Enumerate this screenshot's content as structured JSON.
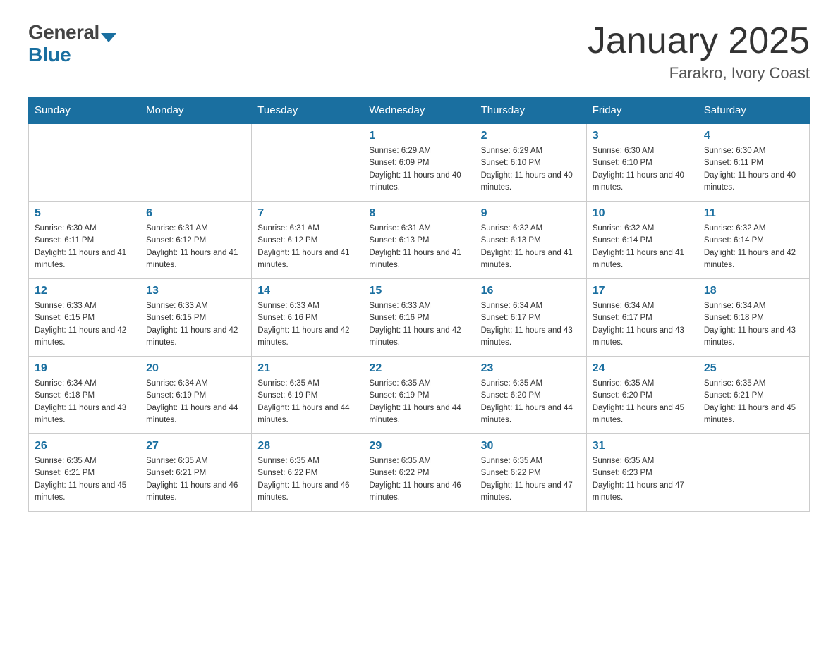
{
  "header": {
    "logo_general": "General",
    "logo_icon": "▼",
    "logo_blue": "Blue",
    "month_title": "January 2025",
    "location": "Farakro, Ivory Coast"
  },
  "days_of_week": [
    "Sunday",
    "Monday",
    "Tuesday",
    "Wednesday",
    "Thursday",
    "Friday",
    "Saturday"
  ],
  "weeks": [
    [
      {
        "day": "",
        "sunrise": "",
        "sunset": "",
        "daylight": ""
      },
      {
        "day": "",
        "sunrise": "",
        "sunset": "",
        "daylight": ""
      },
      {
        "day": "",
        "sunrise": "",
        "sunset": "",
        "daylight": ""
      },
      {
        "day": "1",
        "sunrise": "Sunrise: 6:29 AM",
        "sunset": "Sunset: 6:09 PM",
        "daylight": "Daylight: 11 hours and 40 minutes."
      },
      {
        "day": "2",
        "sunrise": "Sunrise: 6:29 AM",
        "sunset": "Sunset: 6:10 PM",
        "daylight": "Daylight: 11 hours and 40 minutes."
      },
      {
        "day": "3",
        "sunrise": "Sunrise: 6:30 AM",
        "sunset": "Sunset: 6:10 PM",
        "daylight": "Daylight: 11 hours and 40 minutes."
      },
      {
        "day": "4",
        "sunrise": "Sunrise: 6:30 AM",
        "sunset": "Sunset: 6:11 PM",
        "daylight": "Daylight: 11 hours and 40 minutes."
      }
    ],
    [
      {
        "day": "5",
        "sunrise": "Sunrise: 6:30 AM",
        "sunset": "Sunset: 6:11 PM",
        "daylight": "Daylight: 11 hours and 41 minutes."
      },
      {
        "day": "6",
        "sunrise": "Sunrise: 6:31 AM",
        "sunset": "Sunset: 6:12 PM",
        "daylight": "Daylight: 11 hours and 41 minutes."
      },
      {
        "day": "7",
        "sunrise": "Sunrise: 6:31 AM",
        "sunset": "Sunset: 6:12 PM",
        "daylight": "Daylight: 11 hours and 41 minutes."
      },
      {
        "day": "8",
        "sunrise": "Sunrise: 6:31 AM",
        "sunset": "Sunset: 6:13 PM",
        "daylight": "Daylight: 11 hours and 41 minutes."
      },
      {
        "day": "9",
        "sunrise": "Sunrise: 6:32 AM",
        "sunset": "Sunset: 6:13 PM",
        "daylight": "Daylight: 11 hours and 41 minutes."
      },
      {
        "day": "10",
        "sunrise": "Sunrise: 6:32 AM",
        "sunset": "Sunset: 6:14 PM",
        "daylight": "Daylight: 11 hours and 41 minutes."
      },
      {
        "day": "11",
        "sunrise": "Sunrise: 6:32 AM",
        "sunset": "Sunset: 6:14 PM",
        "daylight": "Daylight: 11 hours and 42 minutes."
      }
    ],
    [
      {
        "day": "12",
        "sunrise": "Sunrise: 6:33 AM",
        "sunset": "Sunset: 6:15 PM",
        "daylight": "Daylight: 11 hours and 42 minutes."
      },
      {
        "day": "13",
        "sunrise": "Sunrise: 6:33 AM",
        "sunset": "Sunset: 6:15 PM",
        "daylight": "Daylight: 11 hours and 42 minutes."
      },
      {
        "day": "14",
        "sunrise": "Sunrise: 6:33 AM",
        "sunset": "Sunset: 6:16 PM",
        "daylight": "Daylight: 11 hours and 42 minutes."
      },
      {
        "day": "15",
        "sunrise": "Sunrise: 6:33 AM",
        "sunset": "Sunset: 6:16 PM",
        "daylight": "Daylight: 11 hours and 42 minutes."
      },
      {
        "day": "16",
        "sunrise": "Sunrise: 6:34 AM",
        "sunset": "Sunset: 6:17 PM",
        "daylight": "Daylight: 11 hours and 43 minutes."
      },
      {
        "day": "17",
        "sunrise": "Sunrise: 6:34 AM",
        "sunset": "Sunset: 6:17 PM",
        "daylight": "Daylight: 11 hours and 43 minutes."
      },
      {
        "day": "18",
        "sunrise": "Sunrise: 6:34 AM",
        "sunset": "Sunset: 6:18 PM",
        "daylight": "Daylight: 11 hours and 43 minutes."
      }
    ],
    [
      {
        "day": "19",
        "sunrise": "Sunrise: 6:34 AM",
        "sunset": "Sunset: 6:18 PM",
        "daylight": "Daylight: 11 hours and 43 minutes."
      },
      {
        "day": "20",
        "sunrise": "Sunrise: 6:34 AM",
        "sunset": "Sunset: 6:19 PM",
        "daylight": "Daylight: 11 hours and 44 minutes."
      },
      {
        "day": "21",
        "sunrise": "Sunrise: 6:35 AM",
        "sunset": "Sunset: 6:19 PM",
        "daylight": "Daylight: 11 hours and 44 minutes."
      },
      {
        "day": "22",
        "sunrise": "Sunrise: 6:35 AM",
        "sunset": "Sunset: 6:19 PM",
        "daylight": "Daylight: 11 hours and 44 minutes."
      },
      {
        "day": "23",
        "sunrise": "Sunrise: 6:35 AM",
        "sunset": "Sunset: 6:20 PM",
        "daylight": "Daylight: 11 hours and 44 minutes."
      },
      {
        "day": "24",
        "sunrise": "Sunrise: 6:35 AM",
        "sunset": "Sunset: 6:20 PM",
        "daylight": "Daylight: 11 hours and 45 minutes."
      },
      {
        "day": "25",
        "sunrise": "Sunrise: 6:35 AM",
        "sunset": "Sunset: 6:21 PM",
        "daylight": "Daylight: 11 hours and 45 minutes."
      }
    ],
    [
      {
        "day": "26",
        "sunrise": "Sunrise: 6:35 AM",
        "sunset": "Sunset: 6:21 PM",
        "daylight": "Daylight: 11 hours and 45 minutes."
      },
      {
        "day": "27",
        "sunrise": "Sunrise: 6:35 AM",
        "sunset": "Sunset: 6:21 PM",
        "daylight": "Daylight: 11 hours and 46 minutes."
      },
      {
        "day": "28",
        "sunrise": "Sunrise: 6:35 AM",
        "sunset": "Sunset: 6:22 PM",
        "daylight": "Daylight: 11 hours and 46 minutes."
      },
      {
        "day": "29",
        "sunrise": "Sunrise: 6:35 AM",
        "sunset": "Sunset: 6:22 PM",
        "daylight": "Daylight: 11 hours and 46 minutes."
      },
      {
        "day": "30",
        "sunrise": "Sunrise: 6:35 AM",
        "sunset": "Sunset: 6:22 PM",
        "daylight": "Daylight: 11 hours and 47 minutes."
      },
      {
        "day": "31",
        "sunrise": "Sunrise: 6:35 AM",
        "sunset": "Sunset: 6:23 PM",
        "daylight": "Daylight: 11 hours and 47 minutes."
      },
      {
        "day": "",
        "sunrise": "",
        "sunset": "",
        "daylight": ""
      }
    ]
  ]
}
